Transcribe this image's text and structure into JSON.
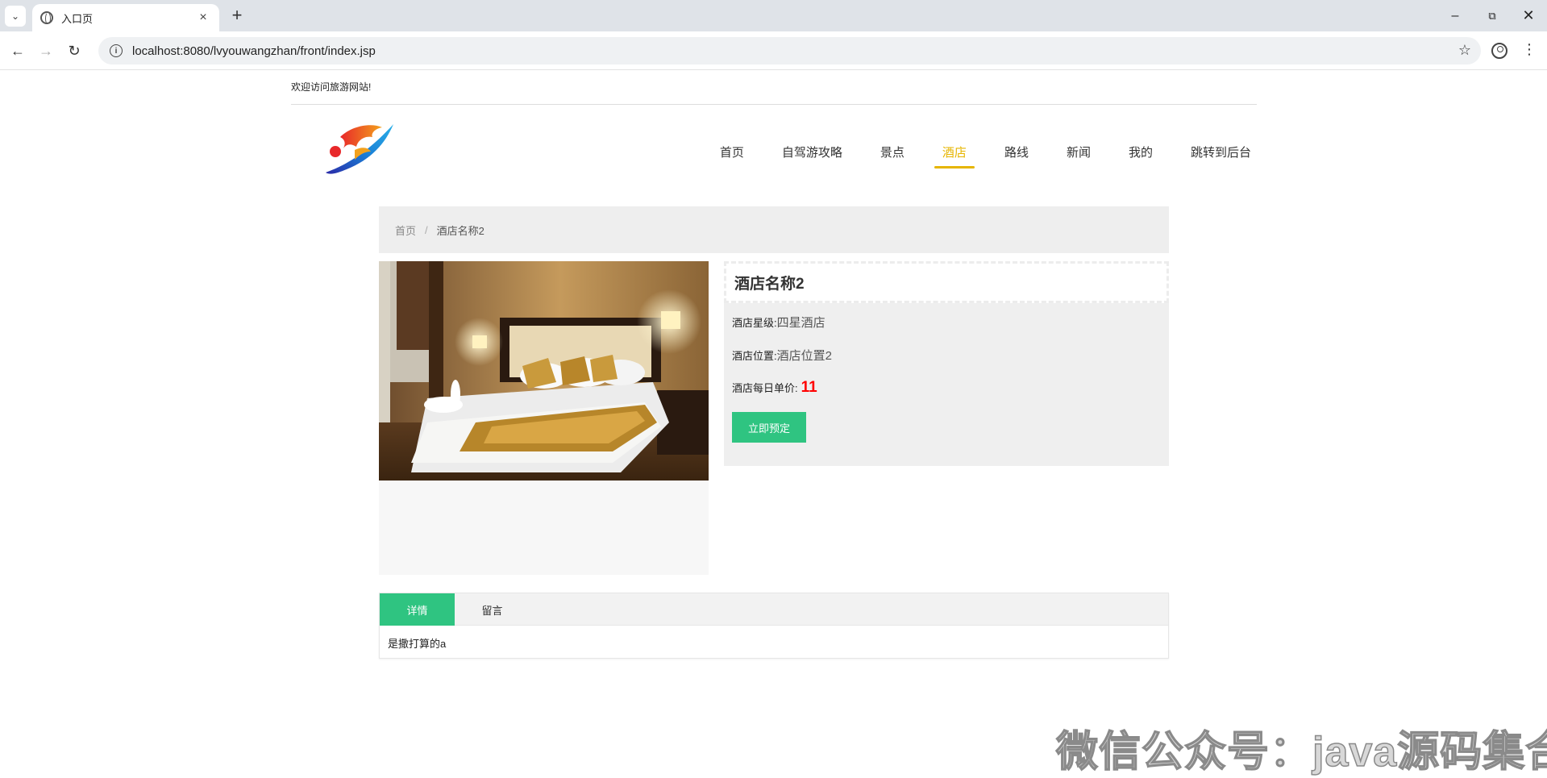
{
  "browser": {
    "tab_title": "入口页",
    "url": "localhost:8080/lvyouwangzhan/front/index.jsp"
  },
  "site": {
    "welcome": "欢迎访问旅游网站!",
    "nav": [
      "首页",
      "自驾游攻略",
      "景点",
      "酒店",
      "路线",
      "新闻",
      "我的",
      "跳转到后台"
    ],
    "active_nav_index": 3,
    "accent_color": "#e6b500"
  },
  "breadcrumb": {
    "home": "首页",
    "separator": "/",
    "current": "酒店名称2"
  },
  "hotel": {
    "name": "酒店名称2",
    "star_label": "酒店星级:",
    "star_value": "四星酒店",
    "location_label": "酒店位置:",
    "location_value": "酒店位置2",
    "price_label": "酒店每日单价:",
    "price_value": "11",
    "book_label": "立即预定",
    "button_color": "#2fc481"
  },
  "detail": {
    "tabs": [
      "详情",
      "留言"
    ],
    "active_tab_index": 0,
    "content": "是撒打算的a"
  },
  "watermark": "微信公众号：java源码集合"
}
